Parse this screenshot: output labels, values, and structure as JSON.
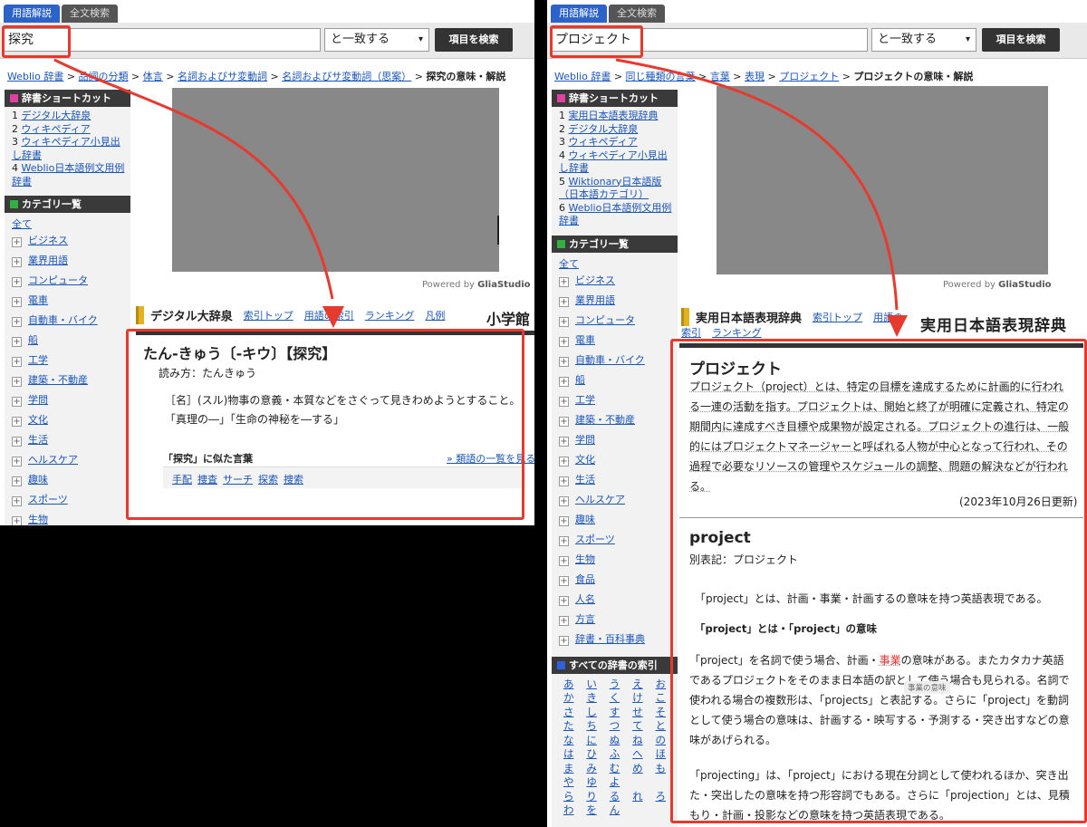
{
  "left": {
    "tabs": [
      "用語解説",
      "全文検索"
    ],
    "search_value": "探究",
    "select_value": "と一致する",
    "search_button": "項目を検索",
    "breadcrumb": [
      "Weblio 辞書",
      "品詞の分類",
      "体言",
      "名詞およびサ変動詞",
      "名詞およびサ変動詞（思案）"
    ],
    "breadcrumb_current": "探究の意味・解説",
    "shortcut_title": "辞書ショートカット",
    "shortcuts": [
      {
        "n": "1",
        "label": "デジタル大辞泉"
      },
      {
        "n": "2",
        "label": "ウィキペディア"
      },
      {
        "n": "3",
        "label": "ウィキペディア小見出し辞書"
      },
      {
        "n": "4",
        "label": "Weblio日本語例文用例辞書"
      }
    ],
    "category_title": "カテゴリ一覧",
    "all_label": "全て",
    "categories": [
      "ビジネス",
      "業界用語",
      "コンピュータ",
      "電車",
      "自動車・バイク",
      "船",
      "工学",
      "建築・不動産",
      "学問",
      "文化",
      "生活",
      "ヘルスケア",
      "趣味",
      "スポーツ",
      "生物"
    ],
    "powered": "Powered by",
    "powered_brand": "GliaStudio",
    "dict_name": "デジタル大辞泉",
    "dict_links": [
      "索引トップ",
      "用語の索引",
      "ランキング",
      "凡例"
    ],
    "dict_logo": "小学館",
    "entry_title": "たん-きゅう〔-キウ〕【探究】",
    "reading": "読み方：たんきゅう",
    "definition": "［名］(スル)物事の意義・本質などをさぐって見きわめようとすること。",
    "examples": "「真理の―」「生命の神秘を―する」",
    "similar_title": "「探究」に似た言葉",
    "similar_more": "» 類語の一覧を見る",
    "similar_words": [
      "手配",
      "捜査",
      "サーチ",
      "探索",
      "捜索"
    ]
  },
  "right": {
    "tabs": [
      "用語解説",
      "全文検索"
    ],
    "search_value": "プロジェクト",
    "select_value": "と一致する",
    "search_button": "項目を検索",
    "breadcrumb": [
      "Weblio 辞書",
      "同じ種類の言葉",
      "言葉",
      "表現",
      "プロジェクト"
    ],
    "breadcrumb_current": "プロジェクトの意味・解説",
    "shortcut_title": "辞書ショートカット",
    "shortcuts": [
      {
        "n": "1",
        "label": "実用日本語表現辞典"
      },
      {
        "n": "2",
        "label": "デジタル大辞泉"
      },
      {
        "n": "3",
        "label": "ウィキペディア"
      },
      {
        "n": "4",
        "label": "ウィキペディア小見出し辞書"
      },
      {
        "n": "5",
        "label": "Wiktionary日本語版（日本語カテゴリ）"
      },
      {
        "n": "6",
        "label": "Weblio日本語例文用例辞書"
      }
    ],
    "category_title": "カテゴリ一覧",
    "all_label": "全て",
    "categories": [
      "ビジネス",
      "業界用語",
      "コンピュータ",
      "電車",
      "自動車・バイク",
      "船",
      "工学",
      "建築・不動産",
      "学問",
      "文化",
      "生活",
      "ヘルスケア",
      "趣味",
      "スポーツ",
      "生物",
      "食品",
      "人名",
      "方言",
      "辞書・百科事典"
    ],
    "index_title": "すべての辞書の索引",
    "kana": [
      "あ",
      "い",
      "う",
      "え",
      "お",
      "か",
      "き",
      "く",
      "け",
      "こ",
      "さ",
      "し",
      "す",
      "せ",
      "そ",
      "た",
      "ち",
      "つ",
      "て",
      "と",
      "な",
      "に",
      "ぬ",
      "ね",
      "の",
      "は",
      "ひ",
      "ふ",
      "へ",
      "ほ",
      "ま",
      "み",
      "む",
      "め",
      "も",
      "や",
      "ゆ",
      "よ",
      "",
      "",
      "ら",
      "り",
      "る",
      "れ",
      "ろ",
      "わ",
      "を",
      "ん",
      "",
      ""
    ],
    "powered": "Powered by",
    "powered_brand": "GliaStudio",
    "dict_name": "実用日本語表現辞典",
    "dict_links": [
      "索引トップ",
      "用語の",
      "索引",
      "ランキング"
    ],
    "dict_logo": "実用日本語表現辞典",
    "entry_title": "プロジェクト",
    "para1": "プロジェクト（project）とは、特定の目標を達成するために計画的に行われる一連の活動を指す。プロジェクトは、開始と終了が明確に定義され、特定の期間内に達成すべき目標や成果物が設定される。プロジェクトの進行は、一般的にはプロジェクトマネージャーと呼ばれる人物が中心となって行われ、その過程で必要なリソースの管理やスケジュールの調整、問題の解決などが行われる。",
    "updated": "(2023年10月26日更新)",
    "entry2_title": "project",
    "alt_notation": "別表記：プロジェクト",
    "para2": "「project」とは、計画・事業・計画するの意味を持つ英語表現である。",
    "subheading": "「project」とは・「project」の意味",
    "para3_pre": "「project」を名詞で使う場合、計画・",
    "para3_red": "事業",
    "para3_post": "の意味がある。またカタカナ英語であるプロジェクトをそのまま日本語の訳として使う場合も見られる。名詞で使われる場合の複数形は、「projects」と表記する。さらに「project」を動詞として使う場合の意味は、計画する・映写する・予測する・突き出すなどの意味があげられる。",
    "tooltip": "事業の意味",
    "para4": "「projecting」は、「project」における現在分詞として使われるほか、突き出た・突出したの意味を持つ形容詞でもある。さらに「projection」とは、見積もり・計画・投影などの意味を持つ英語表現である。"
  },
  "colors": {
    "annotation": "#e73a2e",
    "link": "#1a55b8",
    "tab_active": "#2d63c8"
  }
}
